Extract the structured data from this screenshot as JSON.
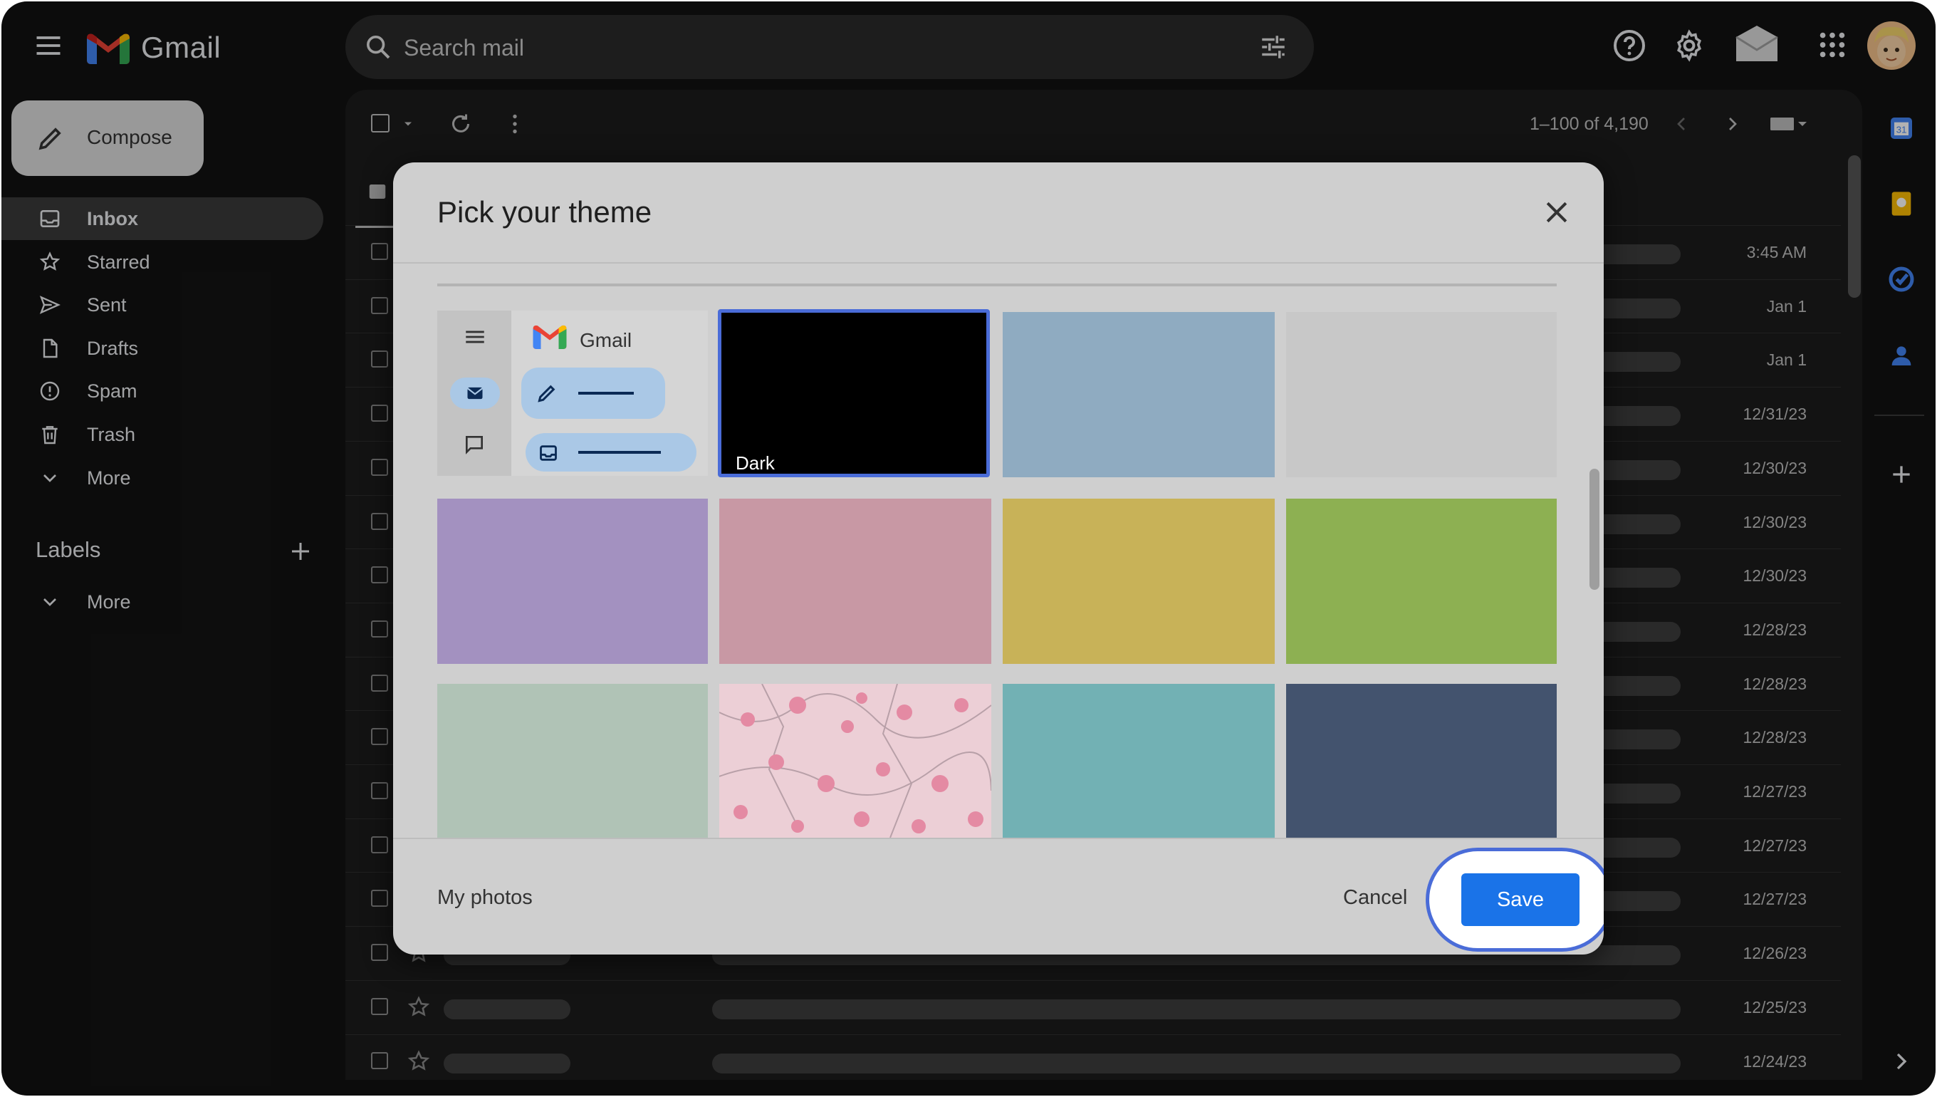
{
  "app": {
    "name": "Gmail"
  },
  "search": {
    "placeholder": "Search mail"
  },
  "sidebar": {
    "compose_label": "Compose",
    "items": [
      {
        "label": "Inbox",
        "icon": "inbox-icon"
      },
      {
        "label": "Starred",
        "icon": "star-icon"
      },
      {
        "label": "Sent",
        "icon": "send-icon"
      },
      {
        "label": "Drafts",
        "icon": "draft-icon"
      },
      {
        "label": "Spam",
        "icon": "spam-icon"
      },
      {
        "label": "Trash",
        "icon": "trash-icon"
      },
      {
        "label": "More",
        "icon": "chevron-down-icon"
      }
    ],
    "labels_title": "Labels",
    "labels_more": "More"
  },
  "main": {
    "pagination": "1–100 of 4,190",
    "dates": [
      "3:45 AM",
      "Jan 1",
      "Jan 1",
      "12/31/23",
      "12/30/23",
      "12/30/23",
      "12/30/23",
      "12/28/23",
      "12/28/23",
      "12/28/23",
      "12/27/23",
      "12/27/23",
      "12/27/23",
      "12/26/23",
      "12/25/23",
      "12/24/23"
    ]
  },
  "modal": {
    "title": "Pick your theme",
    "preview": {
      "app_name": "Gmail"
    },
    "themes": [
      {
        "label": "Dark",
        "color": "#000000",
        "selected": true
      },
      {
        "color": "#8fabc1"
      },
      {
        "color": "#c8c8c8"
      },
      {
        "color": "#a391c0"
      },
      {
        "color": "#c898a4"
      },
      {
        "color": "#c8b258"
      },
      {
        "color": "#8db052"
      },
      {
        "color": "#b0c3b6"
      },
      {
        "color": "#eccfd6",
        "pattern": "cherry-blossom"
      },
      {
        "color": "#72b1b4"
      },
      {
        "color": "#43536e"
      }
    ],
    "my_photos_label": "My photos",
    "cancel_label": "Cancel",
    "save_label": "Save"
  },
  "colors": {
    "accent": "#1a73e8",
    "highlight_ring": "#4a6cd8",
    "background": "#121212"
  }
}
